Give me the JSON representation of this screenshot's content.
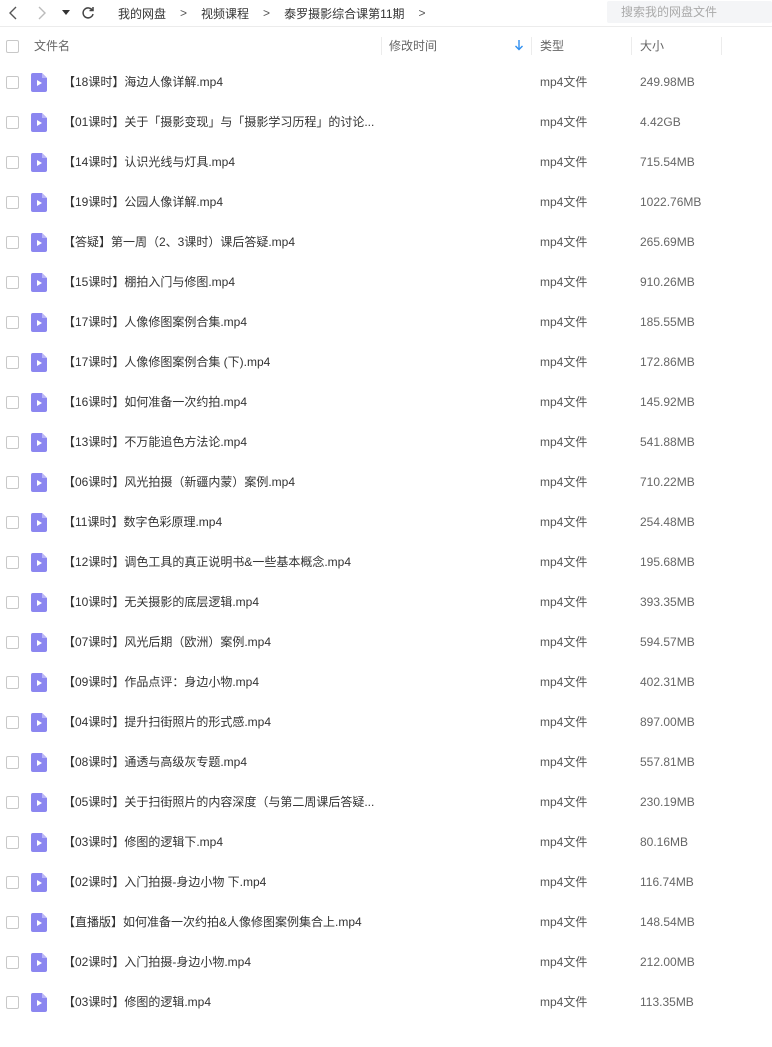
{
  "toolbar": {
    "back_icon": "chevron-left-icon",
    "forward_icon": "chevron-right-icon",
    "dropdown_icon": "caret-down-icon",
    "refresh_icon": "refresh-icon"
  },
  "breadcrumb": {
    "items": [
      "我的网盘",
      "视频课程",
      "泰罗摄影综合课第11期"
    ],
    "separator": ">"
  },
  "search": {
    "placeholder": "搜索我的网盘文件"
  },
  "columns": {
    "name": "文件名",
    "modified": "修改时间",
    "type": "类型",
    "size": "大小"
  },
  "colors": {
    "icon": "#8b86f0",
    "sort_arrow": "#2f8ff0"
  },
  "files": [
    {
      "name": "【18课时】海边人像详解.mp4",
      "type": "mp4文件",
      "size": "249.98MB"
    },
    {
      "name": "【01课时】关于「摄影变现」与「摄影学习历程」的讨论...",
      "type": "mp4文件",
      "size": "4.42GB"
    },
    {
      "name": "【14课时】认识光线与灯具.mp4",
      "type": "mp4文件",
      "size": "715.54MB"
    },
    {
      "name": "【19课时】公园人像详解.mp4",
      "type": "mp4文件",
      "size": "1022.76MB"
    },
    {
      "name": "【答疑】第一周（2、3课时）课后答疑.mp4",
      "type": "mp4文件",
      "size": "265.69MB"
    },
    {
      "name": "【15课时】棚拍入门与修图.mp4",
      "type": "mp4文件",
      "size": "910.26MB"
    },
    {
      "name": "【17课时】人像修图案例合集.mp4",
      "type": "mp4文件",
      "size": "185.55MB"
    },
    {
      "name": "【17课时】人像修图案例合集 (下).mp4",
      "type": "mp4文件",
      "size": "172.86MB"
    },
    {
      "name": "【16课时】如何准备一次约拍.mp4",
      "type": "mp4文件",
      "size": "145.92MB"
    },
    {
      "name": "【13课时】不万能追色方法论.mp4",
      "type": "mp4文件",
      "size": "541.88MB"
    },
    {
      "name": "【06课时】风光拍摄（新疆内蒙）案例.mp4",
      "type": "mp4文件",
      "size": "710.22MB"
    },
    {
      "name": "【11课时】数字色彩原理.mp4",
      "type": "mp4文件",
      "size": "254.48MB"
    },
    {
      "name": "【12课时】调色工具的真正说明书&一些基本概念.mp4",
      "type": "mp4文件",
      "size": "195.68MB"
    },
    {
      "name": "【10课时】无关摄影的底层逻辑.mp4",
      "type": "mp4文件",
      "size": "393.35MB"
    },
    {
      "name": "【07课时】风光后期（欧洲）案例.mp4",
      "type": "mp4文件",
      "size": "594.57MB"
    },
    {
      "name": "【09课时】作品点评：身边小物.mp4",
      "type": "mp4文件",
      "size": "402.31MB"
    },
    {
      "name": "【04课时】提升扫街照片的形式感.mp4",
      "type": "mp4文件",
      "size": "897.00MB"
    },
    {
      "name": "【08课时】通透与高级灰专题.mp4",
      "type": "mp4文件",
      "size": "557.81MB"
    },
    {
      "name": "【05课时】关于扫街照片的内容深度（与第二周课后答疑...",
      "type": "mp4文件",
      "size": "230.19MB"
    },
    {
      "name": "【03课时】修图的逻辑下.mp4",
      "type": "mp4文件",
      "size": "80.16MB"
    },
    {
      "name": "【02课时】入门拍摄-身边小物 下.mp4",
      "type": "mp4文件",
      "size": "116.74MB"
    },
    {
      "name": "【直播版】如何准备一次约拍&人像修图案例集合上.mp4",
      "type": "mp4文件",
      "size": "148.54MB"
    },
    {
      "name": "【02课时】入门拍摄-身边小物.mp4",
      "type": "mp4文件",
      "size": "212.00MB"
    },
    {
      "name": "【03课时】修图的逻辑.mp4",
      "type": "mp4文件",
      "size": "113.35MB"
    }
  ]
}
